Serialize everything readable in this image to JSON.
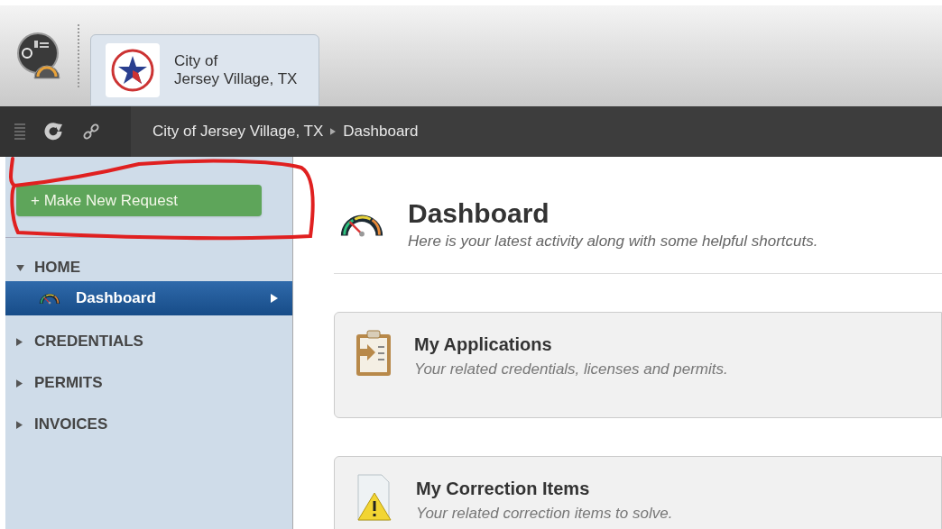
{
  "header": {
    "org_name_line1": "City of",
    "org_name_line2": "Jersey Village, TX"
  },
  "toolbar": {
    "breadcrumb": [
      "City of Jersey Village, TX",
      "Dashboard"
    ]
  },
  "sidebar": {
    "new_request_button": "+ Make New Request",
    "annotation_circle": true,
    "sections": [
      {
        "label": "HOME",
        "expanded": true,
        "children": [
          {
            "label": "Dashboard",
            "selected": true
          }
        ]
      },
      {
        "label": "CREDENTIALS",
        "expanded": false
      },
      {
        "label": "PERMITS",
        "expanded": false
      },
      {
        "label": "INVOICES",
        "expanded": false
      }
    ]
  },
  "page": {
    "title": "Dashboard",
    "subtitle": "Here is your latest activity along with some helpful shortcuts.",
    "cards": [
      {
        "kind": "applications",
        "title": "My Applications",
        "description": "Your related credentials, licenses and permits."
      },
      {
        "kind": "corrections",
        "title": "My Correction Items",
        "description": "Your related correction items to solve."
      }
    ]
  }
}
